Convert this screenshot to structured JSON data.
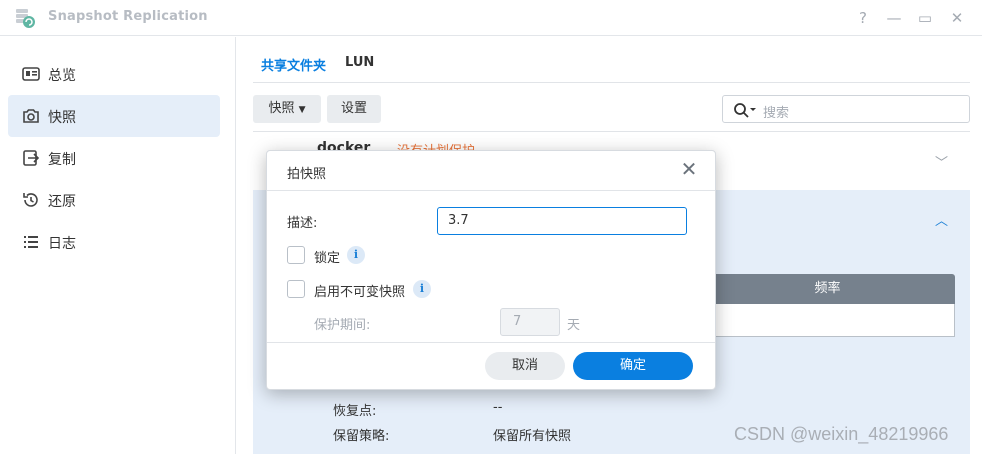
{
  "window": {
    "title": "Snapshot Replication",
    "help_glyph": "?",
    "minimize_glyph": "—",
    "maximize_glyph": "▭",
    "close_glyph": "✕"
  },
  "sidebar": {
    "items": [
      {
        "label": "总览",
        "icon": "overview-icon",
        "active": false
      },
      {
        "label": "快照",
        "icon": "camera-icon",
        "active": true
      },
      {
        "label": "复制",
        "icon": "replicate-icon",
        "active": false
      },
      {
        "label": "还原",
        "icon": "restore-icon",
        "active": false
      },
      {
        "label": "日志",
        "icon": "log-icon",
        "active": false
      }
    ]
  },
  "main": {
    "tabs": [
      {
        "label": "共享文件夹",
        "active": true
      },
      {
        "label": "LUN",
        "active": false
      }
    ],
    "toolbar": {
      "snapshot_label": "快照",
      "settings_label": "设置",
      "search_placeholder": "搜索"
    },
    "row": {
      "name": "docker",
      "status": "没有计划保护"
    },
    "table": {
      "header_frequency": "频率"
    },
    "details": [
      {
        "label": "恢复点:",
        "value": "--"
      },
      {
        "label": "保留策略:",
        "value": "保留所有快照"
      }
    ]
  },
  "dialog": {
    "title": "拍快照",
    "close_glyph": "✕",
    "description_label": "描述:",
    "description_value": "3.7",
    "lock_label": "锁定",
    "immutable_label": "启用不可变快照",
    "info_glyph": "i",
    "protection_label": "保护期间:",
    "protection_value": "7",
    "protection_unit": "天",
    "cancel_label": "取消",
    "ok_label": "确定"
  },
  "watermark": "CSDN @weixin_48219966",
  "colors": {
    "accent": "#0a7fe0",
    "warning": "#e8743b",
    "selected_bg": "#e5eef9",
    "table_header": "#76818d"
  }
}
